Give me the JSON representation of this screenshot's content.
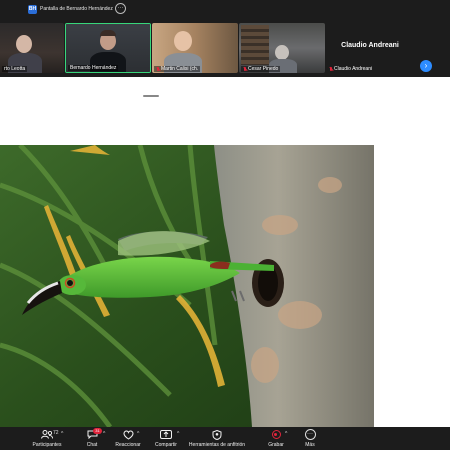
{
  "topbar": {
    "avatar_initials": "BH",
    "share_label": "Pantalla de Bernardo Hernández",
    "more_glyph": "···"
  },
  "participants": [
    {
      "name": "rto Leotta",
      "muted": false
    },
    {
      "name": "Bernardo Hernández",
      "muted": false,
      "active_speaker": true
    },
    {
      "name": "Martin Calisi (ch.",
      "muted": true
    },
    {
      "name": "Cesar Pinedo",
      "muted": true
    }
  ],
  "name_only_tile": {
    "name": "Claudio Andreani",
    "label": "Claudio Andreani",
    "muted": true
  },
  "strip_next_glyph": "›",
  "shared_content": {
    "description_icon": "photo-toucanet"
  },
  "toolbar": {
    "participants_label": "Participantes",
    "participants_count": "72",
    "chat_label": "Chat",
    "chat_badge": "31",
    "reactions_label": "Reaccionar",
    "share_label": "Compartir",
    "host_tools_label": "Herramientas de anfitrión",
    "record_label": "Grabar",
    "more_label": "Más",
    "caret": "^"
  },
  "colors": {
    "background_dark": "#1c1c1c",
    "accent_blue": "#2d8cff",
    "active_speaker_border": "#37d67a",
    "muted_red": "#e0243b"
  }
}
